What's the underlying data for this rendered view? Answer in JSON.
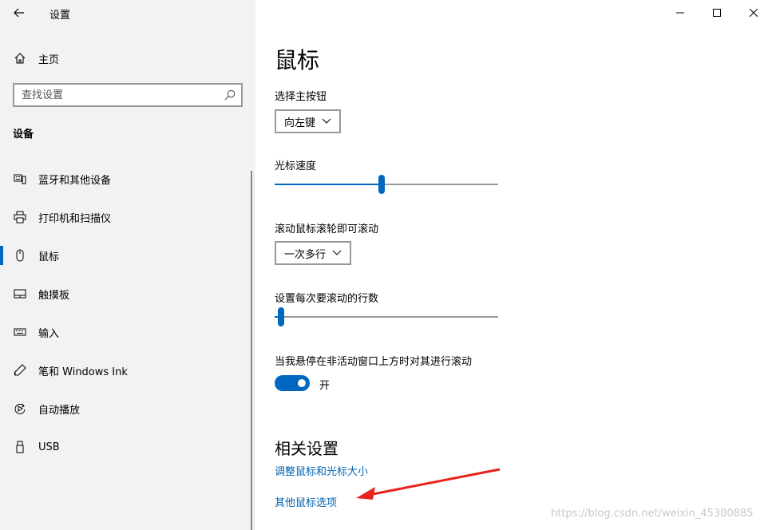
{
  "window": {
    "app_title": "设置"
  },
  "sidebar": {
    "home_label": "主页",
    "search_placeholder": "查找设置",
    "section_title": "设备",
    "items": [
      {
        "label": "蓝牙和其他设备",
        "icon": "bluetooth-devices-icon"
      },
      {
        "label": "打印机和扫描仪",
        "icon": "printer-icon"
      },
      {
        "label": "鼠标",
        "icon": "mouse-icon",
        "active": true
      },
      {
        "label": "触摸板",
        "icon": "touchpad-icon"
      },
      {
        "label": "输入",
        "icon": "keyboard-icon"
      },
      {
        "label": "笔和 Windows Ink",
        "icon": "pen-icon"
      },
      {
        "label": "自动播放",
        "icon": "autoplay-icon"
      },
      {
        "label": "USB",
        "icon": "usb-icon"
      }
    ]
  },
  "main": {
    "title": "鼠标",
    "primary_button": {
      "label": "选择主按钮",
      "value": "向左键"
    },
    "cursor_speed": {
      "label": "光标速度",
      "level": 0.48
    },
    "scroll_mode": {
      "label": "滚动鼠标滚轮即可滚动",
      "value": "一次多行"
    },
    "scroll_lines": {
      "label": "设置每次要滚动的行数",
      "level": 0.03
    },
    "inactive_scroll": {
      "label": "当我悬停在非活动窗口上方时对其进行滚动",
      "state_text": "开",
      "on": true
    },
    "related": {
      "title": "相关设置",
      "links": [
        "调整鼠标和光标大小",
        "其他鼠标选项"
      ]
    }
  },
  "watermark": "https://blog.csdn.net/weixin_45380885",
  "colors": {
    "accent": "#0067c0",
    "link": "#0063b1",
    "sidebar_bg": "#f2f2f2",
    "annotation_arrow": "#e8231c"
  }
}
